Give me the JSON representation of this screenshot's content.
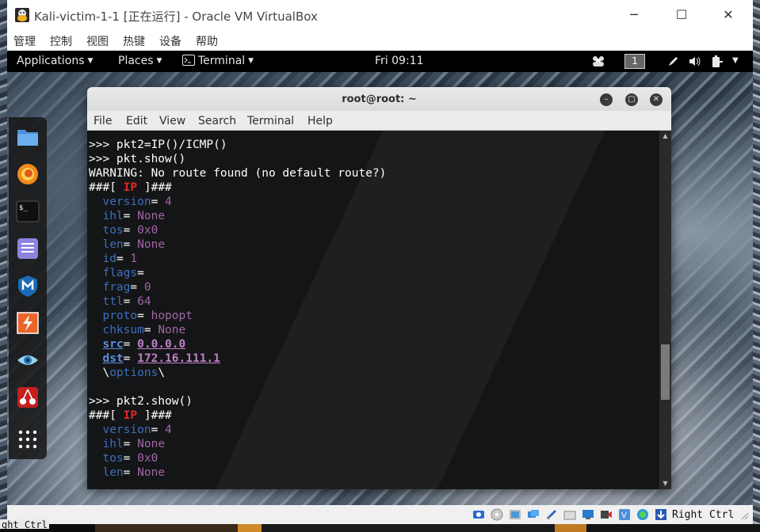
{
  "host": {
    "taskbar_fragment": "ght Ctrl"
  },
  "vbox": {
    "title": "Kali-victim-1-1 [正在运行] - Oracle VM VirtualBox",
    "menu": [
      "管理",
      "控制",
      "视图",
      "热键",
      "设备",
      "帮助"
    ],
    "host_key": "Right Ctrl"
  },
  "gnome": {
    "applications": "Applications",
    "places": "Places",
    "terminal": "Terminal",
    "clock": "Fri 09:11",
    "workspace": "1"
  },
  "dock": {
    "items": [
      "files-icon",
      "firefox-icon",
      "terminal-icon",
      "notes-icon",
      "metasploit-icon",
      "burp-icon",
      "eye-icon",
      "cherrytree-icon",
      "app-grid-icon"
    ]
  },
  "terminal": {
    "title": "root@root: ~",
    "menu": [
      "File",
      "Edit",
      "View",
      "Search",
      "Terminal",
      "Help"
    ],
    "scroll_fraction": 0.72,
    "lines": [
      {
        "prompt": ">>> ",
        "text": "pkt2=IP()/ICMP()"
      },
      {
        "prompt": ">>> ",
        "text": "pkt.show()"
      },
      {
        "plain": "WARNING: No route found (no default route?)"
      },
      {
        "header": "IP"
      },
      {
        "field": "version",
        "value": "4"
      },
      {
        "field": "ihl",
        "value": "None"
      },
      {
        "field": "tos",
        "value": "0x0"
      },
      {
        "field": "len",
        "value": "None"
      },
      {
        "field": "id",
        "value": "1"
      },
      {
        "field": "flags",
        "value": ""
      },
      {
        "field": "frag",
        "value": "0"
      },
      {
        "field": "ttl",
        "value": "64"
      },
      {
        "field": "proto",
        "value": "hopopt"
      },
      {
        "field": "chksum",
        "value": "None"
      },
      {
        "field": "src",
        "value": "0.0.0.0",
        "underline": true
      },
      {
        "field": "dst",
        "value": "172.16.111.1",
        "underline": true
      },
      {
        "options": "options"
      },
      {
        "plain": ""
      },
      {
        "prompt": ">>> ",
        "text": "pkt2.show()"
      },
      {
        "header": "IP"
      },
      {
        "field": "version",
        "value": "4"
      },
      {
        "field": "ihl",
        "value": "None"
      },
      {
        "field": "tos",
        "value": "0x0"
      },
      {
        "field": "len",
        "value": "None"
      }
    ]
  }
}
